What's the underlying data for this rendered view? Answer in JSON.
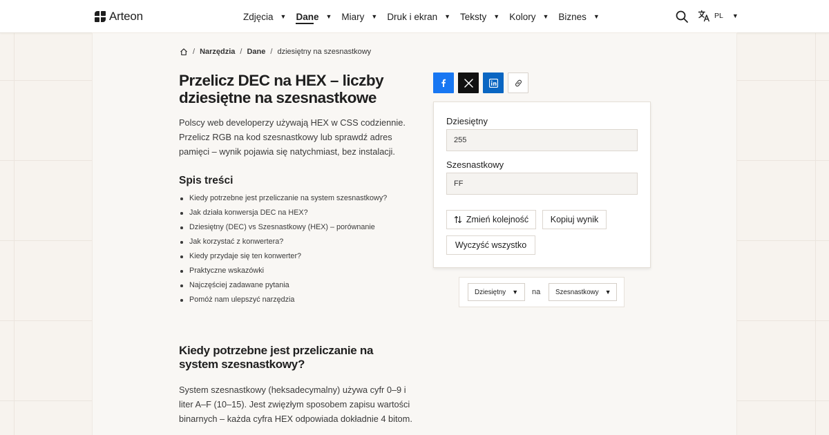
{
  "header": {
    "logo_text": "Arteon",
    "nav": [
      {
        "label": "Zdjęcia",
        "active": false
      },
      {
        "label": "Dane",
        "active": true
      },
      {
        "label": "Miary",
        "active": false
      },
      {
        "label": "Druk i ekran",
        "active": false
      },
      {
        "label": "Teksty",
        "active": false
      },
      {
        "label": "Kolory",
        "active": false
      },
      {
        "label": "Biznes",
        "active": false
      }
    ],
    "lang": "PL",
    "icons": {
      "search": "search-icon",
      "translate": "translate-icon",
      "home": "home-icon"
    }
  },
  "breadcrumb": {
    "items": [
      "Narzędzia",
      "Dane"
    ],
    "current": "dziesiętny na szesnastkowy"
  },
  "page": {
    "title": "Przelicz DEC na HEX – liczby dziesiętne na szesnastkowe",
    "intro": "Polscy web developerzy używają HEX w CSS codziennie. Przelicz RGB na kod szesnastkowy lub sprawdź adres pamięci – wynik pojawia się natychmiast, bez instalacji.",
    "toc_title": "Spis treści",
    "toc": [
      "Kiedy potrzebne jest przeliczanie na system szesnastkowy?",
      "Jak działa konwersja DEC na HEX?",
      "Dziesiętny (DEC) vs Szesnastkowy (HEX) – porównanie",
      "Jak korzystać z konwertera?",
      "Kiedy przydaje się ten konwerter?",
      "Praktyczne wskazówki",
      "Najczęściej zadawane pytania",
      "Pomóż nam ulepszyć narzędzia"
    ],
    "section_title": "Kiedy potrzebne jest przeliczanie na system szesnastkowy?",
    "section_text": "System szesnastkowy (heksadecymalny) używa cyfr 0–9 i liter A–F (10–15). Jest zwięzłym sposobem zapisu wartości binarnych – każda cyfra HEX odpowiada dokładnie 4 bitom."
  },
  "share": {
    "icons": [
      "facebook-icon",
      "x-icon",
      "linkedin-icon",
      "link-icon"
    ],
    "colors": {
      "facebook": "#1877f2",
      "x": "#111111",
      "linkedin": "#0a66c2"
    }
  },
  "converter": {
    "decimal_label": "Dziesiętny",
    "decimal_value": "255",
    "hex_label": "Szesnastkowy",
    "hex_value": "FF",
    "swap_label": "Zmień kolejność",
    "copy_label": "Kopiuj wynik",
    "clear_label": "Wyczyść wszystko"
  },
  "units": {
    "from": "Dziesiętny",
    "connector": "na",
    "to": "Szesnastkowy"
  }
}
